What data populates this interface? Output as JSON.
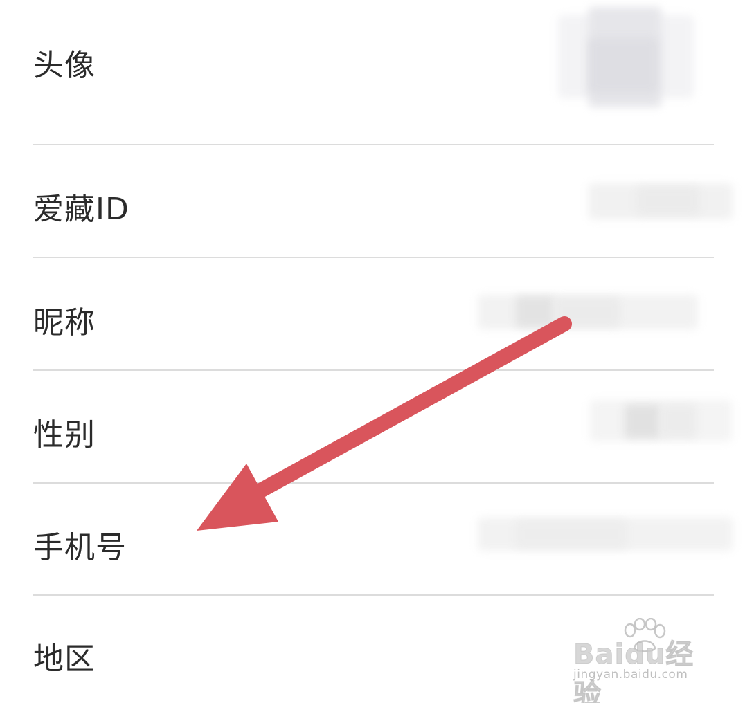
{
  "profile": {
    "rows": [
      {
        "label": "头像"
      },
      {
        "label": "爱藏ID"
      },
      {
        "label": "昵称"
      },
      {
        "label": "性别"
      },
      {
        "label": "手机号"
      },
      {
        "label": "地区"
      }
    ]
  },
  "annotation": {
    "arrow_color": "#d9555c"
  },
  "watermark": {
    "brand": "Baidu经验",
    "url": "jingyan.baidu.com"
  }
}
